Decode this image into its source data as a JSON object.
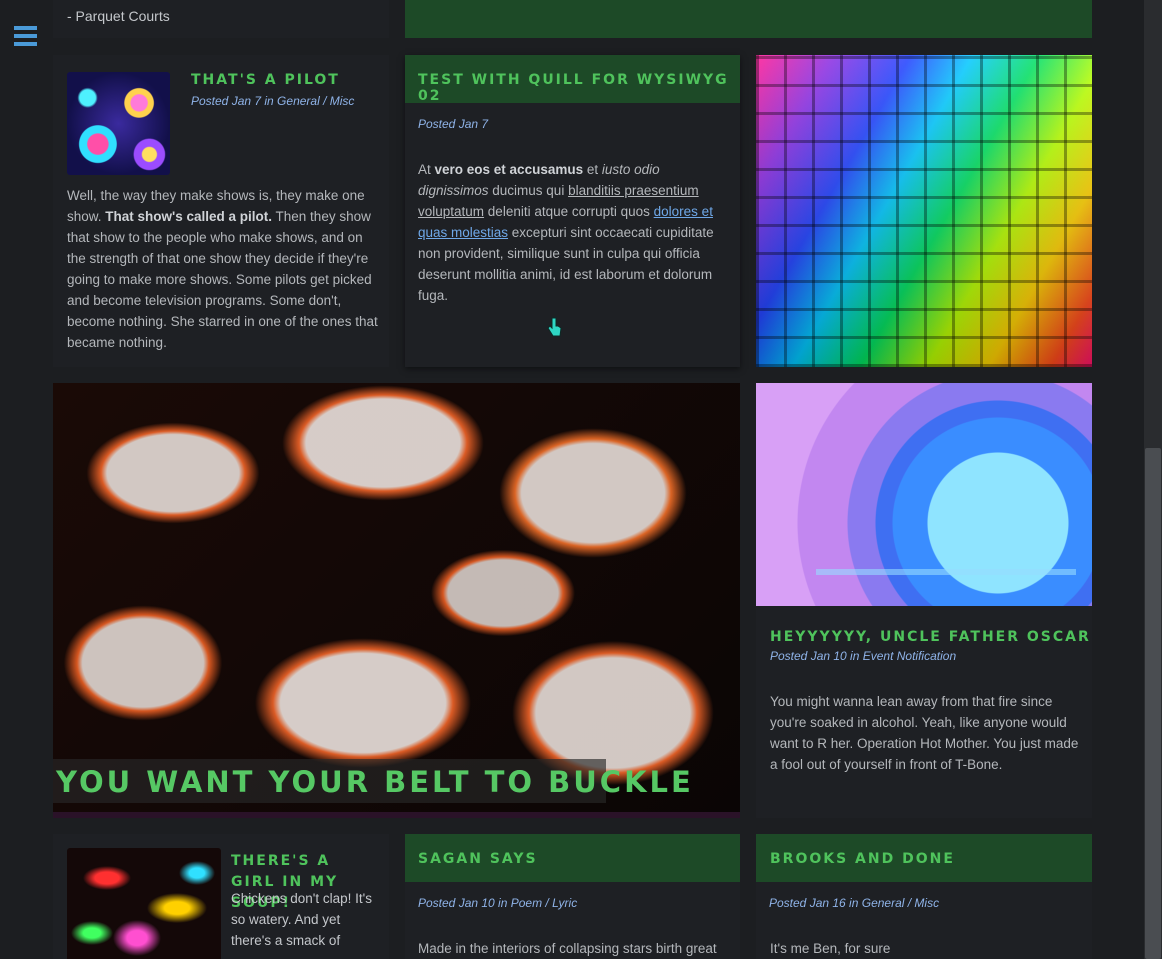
{
  "menu": {
    "icon": "hamburger-menu-icon"
  },
  "top_left": {
    "text": "- Parquet Courts"
  },
  "posts": {
    "pilot": {
      "title": "That's a Pilot",
      "meta": "Posted Jan 7 in General / Misc",
      "body_1": "Well, the way they make shows is, they make one show. ",
      "body_bold": "That show's called a pilot.",
      "body_2": " Then they show that show to the people who make shows, and on the strength of that one show they decide if they're going to make more shows. Some pilots get picked and become television programs. Some don't, become nothing. She starred in one of the ones that became nothing."
    },
    "quill": {
      "title": "Test with Quill for WYSIWYG 02",
      "meta": "Posted Jan 7",
      "t1": "At ",
      "t2": "vero eos et accusamus",
      "t3": " et ",
      "t4": "iusto odio dignissimos",
      "t5": " ducimus qui ",
      "t6": "blanditiis praesentium voluptatum",
      "t7": " deleniti atque corrupti quos ",
      "t8": "dolores et quas molestias",
      "t9": " excepturi sint occaecati cupiditate non provident, similique sunt in culpa qui officia deserunt mollitia animi, id est laborum et dolorum fuga."
    },
    "belt": {
      "title": "You Want Your Belt To Buckle"
    },
    "oscar": {
      "title": "Heyyyyyy, Uncle Father Oscar",
      "meta": "Posted Jan 10 in Event Notification",
      "body": "You might wanna lean away from that fire since you're soaked in alcohol. Yeah, like anyone would want to R her. Operation Hot Mother. You just made a fool out of yourself in front of T-Bone."
    },
    "soup": {
      "title": "There's a Girl in My Soup!",
      "body": "Chickens don't clap! It's so watery. And yet there's a smack of"
    },
    "sagan": {
      "title": "Sagan Says",
      "meta": "Posted Jan 10 in Poem / Lyric",
      "body": "Made in the interiors of collapsing stars birth great"
    },
    "brooks": {
      "title": "Brooks and Done",
      "meta": "Posted Jan 16 in General / Misc",
      "body": "It's me Ben, for sure"
    }
  },
  "colors": {
    "accent_green": "#4fc35c",
    "header_green": "#1d4a27",
    "meta_blue": "#8fb3e8",
    "background": "#1c1e21"
  }
}
